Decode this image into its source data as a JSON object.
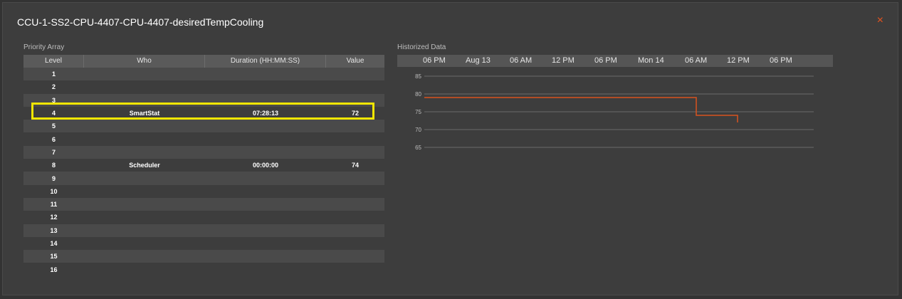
{
  "dialog": {
    "title": "CCU-1-SS2-CPU-4407-CPU-4407-desiredTempCooling",
    "close_icon": "×"
  },
  "priority_array": {
    "label": "Priority Array",
    "columns": [
      "Level",
      "Who",
      "Duration (HH:MM:SS)",
      "Value"
    ],
    "rows": [
      {
        "level": "1",
        "who": "",
        "duration": "",
        "value": ""
      },
      {
        "level": "2",
        "who": "",
        "duration": "",
        "value": ""
      },
      {
        "level": "3",
        "who": "",
        "duration": "",
        "value": ""
      },
      {
        "level": "4",
        "who": "SmartStat",
        "duration": "07:28:13",
        "value": "72"
      },
      {
        "level": "5",
        "who": "",
        "duration": "",
        "value": ""
      },
      {
        "level": "6",
        "who": "",
        "duration": "",
        "value": ""
      },
      {
        "level": "7",
        "who": "",
        "duration": "",
        "value": ""
      },
      {
        "level": "8",
        "who": "Scheduler",
        "duration": "00:00:00",
        "value": "74"
      },
      {
        "level": "9",
        "who": "",
        "duration": "",
        "value": ""
      },
      {
        "level": "10",
        "who": "",
        "duration": "",
        "value": ""
      },
      {
        "level": "11",
        "who": "",
        "duration": "",
        "value": ""
      },
      {
        "level": "12",
        "who": "",
        "duration": "",
        "value": ""
      },
      {
        "level": "13",
        "who": "",
        "duration": "",
        "value": ""
      },
      {
        "level": "14",
        "who": "",
        "duration": "",
        "value": ""
      },
      {
        "level": "15",
        "who": "",
        "duration": "",
        "value": ""
      },
      {
        "level": "16",
        "who": "",
        "duration": "",
        "value": ""
      }
    ],
    "highlight_color": "#f2e600"
  },
  "historized": {
    "label": "Historized Data"
  },
  "chart_data": {
    "type": "line",
    "x_ticks": [
      "06 PM",
      "Aug 13",
      "06 AM",
      "12 PM",
      "06 PM",
      "Mon 14",
      "06 AM",
      "12 PM",
      "06 PM"
    ],
    "y_ticks": [
      65,
      70,
      75,
      80,
      85
    ],
    "ylim": [
      63,
      87
    ],
    "line_color": "#d9531e",
    "series": [
      {
        "points": [
          [
            "06 PM (Aug 12)",
            79
          ],
          [
            "06 AM (Mon 14)",
            79
          ],
          [
            "06 AM (Mon 14)",
            74
          ],
          [
            "~10 AM (Mon 14)",
            74
          ],
          [
            "~10 AM (Mon 14)",
            72
          ]
        ]
      }
    ]
  }
}
